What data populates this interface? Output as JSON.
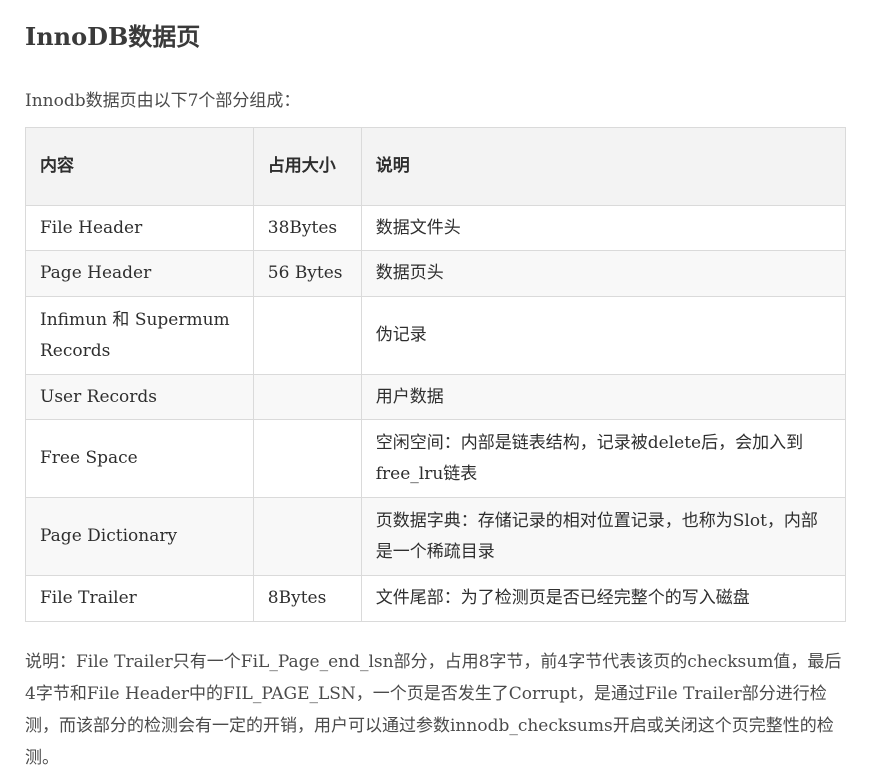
{
  "heading": "InnoDB数据页",
  "intro": "Innodb数据页由以下7个部分组成：",
  "table": {
    "headers": [
      "内容",
      "占用大小",
      "说明"
    ],
    "rows": [
      [
        "File Header",
        "38Bytes",
        "数据文件头"
      ],
      [
        "Page Header",
        "56 Bytes",
        "数据页头"
      ],
      [
        "Infimun 和 Supermum Records",
        "",
        "伪记录"
      ],
      [
        "User Records",
        "",
        "用户数据"
      ],
      [
        "Free Space",
        "",
        "空闲空间：内部是链表结构，记录被delete后，会加入到free_lru链表"
      ],
      [
        "Page  Dictionary",
        "",
        "页数据字典：存储记录的相对位置记录，也称为Slot，内部是一个稀疏目录"
      ],
      [
        "File Trailer",
        "8Bytes",
        "文件尾部：为了检测页是否已经完整个的写入磁盘"
      ]
    ]
  },
  "note": "说明：File Trailer只有一个FiL_Page_end_lsn部分，占用8字节，前4字节代表该页的checksum值，最后4字节和File Header中的FIL_PAGE_LSN，一个页是否发生了Corrupt，是通过File Trailer部分进行检测，而该部分的检测会有一定的开销，用户可以通过参数innodb_checksums开启或关闭这个页完整性的检测。"
}
